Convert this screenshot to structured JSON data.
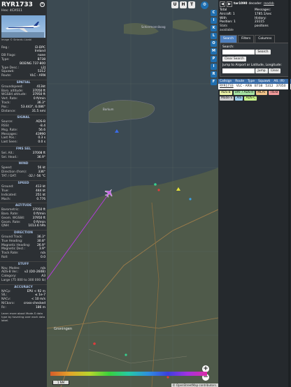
{
  "left": {
    "callsign": "RYR1733",
    "hex": "Hex: 4CA511",
    "photo_credit": "Image © Sirtardu Lizabi",
    "rows1": [
      {
        "k": "Reg.:",
        "v": "EI-DPC"
      },
      {
        "k": "",
        "v": "Ireland"
      },
      {
        "k": "DB Flags:",
        "v": "none"
      },
      {
        "k": "Type:",
        "v": "B738"
      },
      {
        "k": "",
        "v": "BOEING 737-800"
      },
      {
        "k": "Type Desc.:",
        "v": "L2J"
      },
      {
        "k": "Squawk:",
        "v": "5312"
      },
      {
        "k": "Route:",
        "v": "VLC - ARN"
      }
    ],
    "sec_spatial": "SPATIAL",
    "rows_spatial": [
      {
        "k": "Groundspeed:",
        "v": "413kt"
      },
      {
        "k": "Baro. altitude:",
        "v": "37050 ft"
      },
      {
        "k": "WGS84 altitude:",
        "v": "37950 ft"
      },
      {
        "k": "Vert. Rate:",
        "v": "0 ft/min"
      },
      {
        "k": "Track:",
        "v": "36.3°"
      },
      {
        "k": "Pos.:",
        "v": "53.443°, 6.086°"
      },
      {
        "k": "Distance:",
        "v": "31.5 nmi"
      }
    ],
    "sec_signal": "SIGNAL",
    "rows_signal": [
      {
        "k": "Source:",
        "v": "ADS-B"
      },
      {
        "k": "RSSI:",
        "v": "-8.4"
      },
      {
        "k": "Msg. Rate:",
        "v": "56.6"
      },
      {
        "k": "Messages:",
        "v": "43990"
      },
      {
        "k": "Last Pos.:",
        "v": "0.3 s"
      },
      {
        "k": "Last Seen:",
        "v": "0.0 s"
      }
    ],
    "sec_fms": "FMS SEL",
    "rows_fms": [
      {
        "k": "Sel. Alt.:",
        "v": "37008 ft"
      },
      {
        "k": "Sel. Head.:",
        "v": "36.9°"
      }
    ],
    "sec_wind": "WIND",
    "rows_wind": [
      {
        "k": "Speed:",
        "v": "56 kt"
      },
      {
        "k": "Direction (from):",
        "v": "336°"
      },
      {
        "k": "TAT / OAT:",
        "v": "-32 / -56 °C"
      }
    ],
    "sec_speed": "SPEED",
    "rows_speed": [
      {
        "k": "Ground:",
        "v": "413 kt"
      },
      {
        "k": "True:",
        "v": "444 kt"
      },
      {
        "k": "Indicated:",
        "v": "251 kt"
      },
      {
        "k": "Mach:",
        "v": "0.776"
      }
    ],
    "sec_altitude": "ALTITUDE",
    "rows_altitude": [
      {
        "k": "Barometric:",
        "v": "37050 ft"
      },
      {
        "k": "Baro. Rate:",
        "v": "0 ft/min"
      },
      {
        "k": "Geom. WGS84:",
        "v": "37950 ft"
      },
      {
        "k": "Geom. Rate:",
        "v": "0 ft/min"
      },
      {
        "k": "QNH:",
        "v": "1013.6 hPa"
      }
    ],
    "sec_direction": "DIRECTION",
    "rows_direction": [
      {
        "k": "Ground Track:",
        "v": "36.3°"
      },
      {
        "k": "True Heading:",
        "v": "30.8°"
      },
      {
        "k": "Magnetic Heading:",
        "v": "26.9°"
      },
      {
        "k": "Magnetic Decl.:",
        "v": "3.9°"
      },
      {
        "k": "Track Rate:",
        "v": "n/a"
      },
      {
        "k": "Roll:",
        "v": "0.0"
      }
    ],
    "sec_stuff": "STUFF",
    "rows_stuff": [
      {
        "k": "Nav. Modes:",
        "v": "n/a"
      },
      {
        "k": "ADS-B Ver.:",
        "v": "v2 (DO-260B)"
      },
      {
        "k": "Category:",
        "v": "A3"
      },
      {
        "k": "Large (75 000 to 300 000 lb)",
        "v": ""
      }
    ],
    "sec_accuracy": "ACCURACY",
    "rows_accuracy": [
      {
        "k": "NACp:",
        "v": "EPU < 92 m"
      },
      {
        "k": "SIL:",
        "v": "≤ 1e-7"
      },
      {
        "k": "NACv:",
        "v": "< 10 m/s"
      },
      {
        "k": "NICbaro:",
        "v": "cross-checked"
      },
      {
        "k": "Rc:",
        "v": "186 m"
      }
    ],
    "footer": "Learn more about Mode-S data type by hovering over each data label."
  },
  "map": {
    "top_buttons": [
      "U",
      "H",
      "T"
    ],
    "side_buttons": [
      "C",
      "I",
      "K",
      "L",
      "O",
      "M",
      "P",
      "I",
      "R",
      "F"
    ],
    "labels": [
      {
        "text": "Schiermonnikoog"
      },
      {
        "text": "Borkum"
      },
      {
        "text": "Groningen"
      }
    ],
    "zoom_in": "+",
    "zoom_out": "−",
    "attribution": "© OpenStreetMap contributors.",
    "scale_label": "1 NM"
  },
  "right": {
    "title": "tar1090",
    "decoder_label": "decoder:",
    "decoder_value": "readsb",
    "total_aircraft": "Total Aircraft: 1",
    "with_position": "With Position: 1",
    "stats_available": "Stats available",
    "messages": "Messages: 1785.1/sec",
    "history": "History: 23115 positions",
    "tabs": [
      "Search",
      "Filters",
      "Columns"
    ],
    "search_label": "Search:",
    "search_button": "Search",
    "clear_button": "Clear Search",
    "jump_label": "Jump to Airport or Latitude, Longitude:",
    "jump_button": "Jump",
    "clear2_button": "Clear",
    "table_headers": [
      "Callsign",
      "Route",
      "Type",
      "Squawk",
      "Alt. (ft)"
    ],
    "table_row": {
      "callsign": "RYR1733",
      "route": "VLC - ARN",
      "type": "B738",
      "squawk": "5312",
      "alt": "37050"
    },
    "badges": [
      {
        "label": "ADS-B",
        "color": "#e9f0a6"
      },
      {
        "label": "UAT / ADS-R",
        "color": "#a7e3a3"
      },
      {
        "label": "MLAT",
        "color": "#f3c48a"
      },
      {
        "label": "TIS-B",
        "color": "#f29a9a"
      },
      {
        "label": "Mode-S",
        "color": "#cfcfcf"
      },
      {
        "label": "AIS",
        "color": "#9fd0ef"
      },
      {
        "label": "ADS-C",
        "color": "#c9f58a"
      }
    ]
  }
}
